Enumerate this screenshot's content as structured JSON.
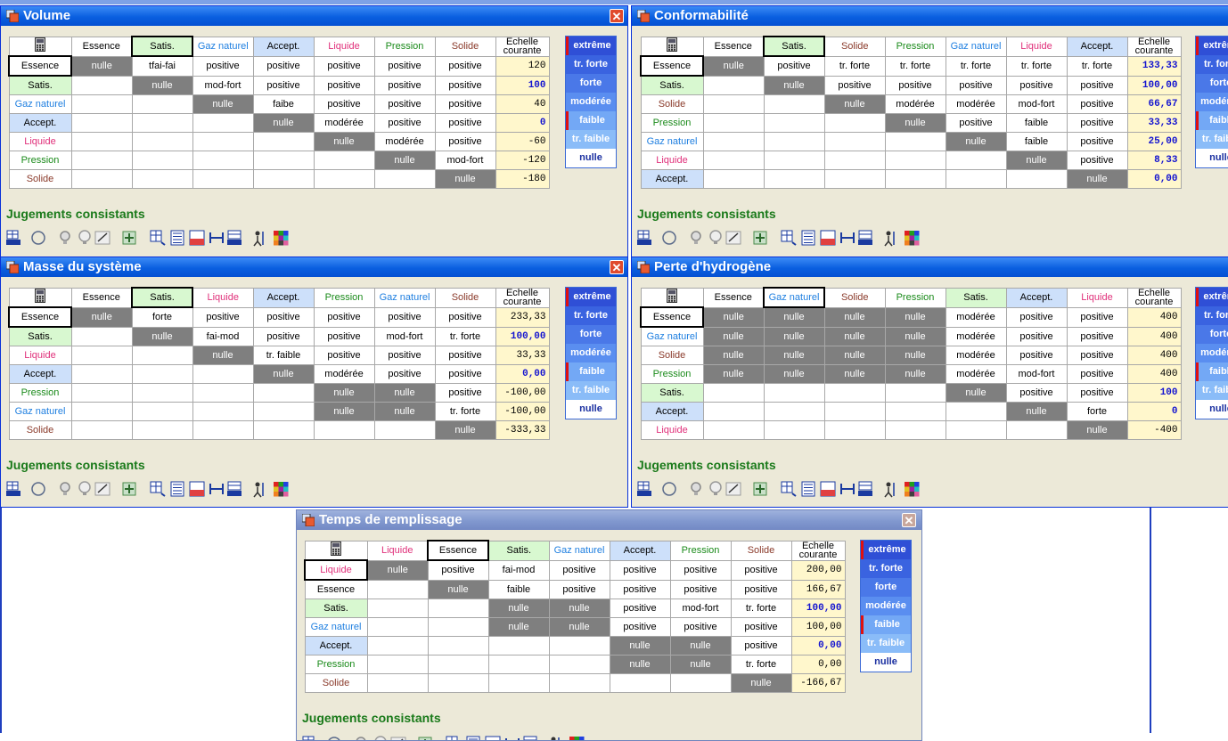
{
  "legend": [
    "extrême",
    "tr. forte",
    "forte",
    "modérée",
    "faible",
    "tr. faible",
    "nulle"
  ],
  "scale_header": [
    "Echelle",
    "courante"
  ],
  "windows": {
    "volume": {
      "title": "Volume",
      "cols": [
        "Essence",
        "Satis.",
        "Gaz naturel",
        "Accept.",
        "Liquide",
        "Pression",
        "Solide"
      ],
      "rows": [
        [
          "nulle",
          "tfai-fai",
          "positive",
          "positive",
          "positive",
          "positive",
          "positive"
        ],
        [
          "",
          "nulle",
          "mod-fort",
          "positive",
          "positive",
          "positive",
          "positive"
        ],
        [
          "",
          "",
          "nulle",
          "faibe",
          "positive",
          "positive",
          "positive"
        ],
        [
          "",
          "",
          "",
          "nulle",
          "modérée",
          "positive",
          "positive"
        ],
        [
          "",
          "",
          "",
          "",
          "nulle",
          "modérée",
          "positive"
        ],
        [
          "",
          "",
          "",
          "",
          "",
          "nulle",
          "mod-fort"
        ],
        [
          "",
          "",
          "",
          "",
          "",
          "",
          "nulle"
        ]
      ],
      "scale": [
        "120",
        "100",
        "40",
        "0",
        "-60",
        "-120",
        "-180"
      ],
      "status": "Jugements consistants"
    },
    "conformabilite": {
      "title": "Conformabilité",
      "cols": [
        "Essence",
        "Satis.",
        "Solide",
        "Pression",
        "Gaz naturel",
        "Liquide",
        "Accept."
      ],
      "rows": [
        [
          "nulle",
          "positive",
          "tr. forte",
          "tr. forte",
          "tr. forte",
          "tr. forte",
          "tr. forte"
        ],
        [
          "",
          "nulle",
          "positive",
          "positive",
          "positive",
          "positive",
          "positive"
        ],
        [
          "",
          "",
          "nulle",
          "modérée",
          "modérée",
          "mod-fort",
          "positive"
        ],
        [
          "",
          "",
          "",
          "nulle",
          "positive",
          "faible",
          "positive"
        ],
        [
          "",
          "",
          "",
          "",
          "nulle",
          "faible",
          "positive"
        ],
        [
          "",
          "",
          "",
          "",
          "",
          "nulle",
          "positive"
        ],
        [
          "",
          "",
          "",
          "",
          "",
          "",
          "nulle"
        ]
      ],
      "scale": [
        "133,33",
        "100,00",
        "66,67",
        "33,33",
        "25,00",
        "8,33",
        "0,00"
      ],
      "status": "Jugements consistants"
    },
    "masse": {
      "title": "Masse du système",
      "cols": [
        "Essence",
        "Satis.",
        "Liquide",
        "Accept.",
        "Pression",
        "Gaz naturel",
        "Solide"
      ],
      "rows": [
        [
          "nulle",
          "forte",
          "positive",
          "positive",
          "positive",
          "positive",
          "positive"
        ],
        [
          "",
          "nulle",
          "fai-mod",
          "positive",
          "positive",
          "mod-fort",
          "tr. forte"
        ],
        [
          "",
          "",
          "nulle",
          "tr. faible",
          "positive",
          "positive",
          "positive"
        ],
        [
          "",
          "",
          "",
          "nulle",
          "modérée",
          "positive",
          "positive"
        ],
        [
          "",
          "",
          "",
          "",
          "nulle",
          "nulle",
          "positive"
        ],
        [
          "",
          "",
          "",
          "",
          "nulle",
          "nulle",
          "tr. forte"
        ],
        [
          "",
          "",
          "",
          "",
          "",
          "",
          "nulle"
        ]
      ],
      "scale": [
        "233,33",
        "100,00",
        "33,33",
        "0,00",
        "-100,00",
        "-100,00",
        "-333,33"
      ],
      "status": "Jugements consistants"
    },
    "perte": {
      "title": "Perte d'hydrogène",
      "cols": [
        "Essence",
        "Gaz naturel",
        "Solide",
        "Pression",
        "Satis.",
        "Accept.",
        "Liquide"
      ],
      "rows": [
        [
          "nulle",
          "nulle",
          "nulle",
          "nulle",
          "modérée",
          "positive",
          "positive"
        ],
        [
          "nulle",
          "nulle",
          "nulle",
          "nulle",
          "modérée",
          "positive",
          "positive"
        ],
        [
          "nulle",
          "nulle",
          "nulle",
          "nulle",
          "modérée",
          "positive",
          "positive"
        ],
        [
          "nulle",
          "nulle",
          "nulle",
          "nulle",
          "modérée",
          "mod-fort",
          "positive"
        ],
        [
          "",
          "",
          "",
          "",
          "nulle",
          "positive",
          "positive"
        ],
        [
          "",
          "",
          "",
          "",
          "",
          "nulle",
          "forte"
        ],
        [
          "",
          "",
          "",
          "",
          "",
          "",
          "nulle"
        ]
      ],
      "scale": [
        "400",
        "400",
        "400",
        "400",
        "100",
        "0",
        "-400"
      ],
      "status": "Jugements consistants"
    },
    "temps": {
      "title": "Temps de remplissage",
      "cols": [
        "Liquide",
        "Essence",
        "Satis.",
        "Gaz naturel",
        "Accept.",
        "Pression",
        "Solide"
      ],
      "rows": [
        [
          "nulle",
          "positive",
          "fai-mod",
          "positive",
          "positive",
          "positive",
          "positive"
        ],
        [
          "",
          "nulle",
          "faible",
          "positive",
          "positive",
          "positive",
          "positive"
        ],
        [
          "",
          "",
          "nulle",
          "nulle",
          "positive",
          "mod-fort",
          "tr. forte"
        ],
        [
          "",
          "",
          "nulle",
          "nulle",
          "positive",
          "positive",
          "positive"
        ],
        [
          "",
          "",
          "",
          "",
          "nulle",
          "nulle",
          "positive"
        ],
        [
          "",
          "",
          "",
          "",
          "nulle",
          "nulle",
          "tr. forte"
        ],
        [
          "",
          "",
          "",
          "",
          "",
          "",
          "nulle"
        ]
      ],
      "scale": [
        "200,00",
        "166,67",
        "100,00",
        "100,00",
        "0,00",
        "0,00",
        "-166,67"
      ],
      "status": "Jugements consistants"
    }
  },
  "colors": {
    "Essence": "#000000",
    "Satis.": "#000000",
    "Gaz naturel": "#1f7fe0",
    "Accept.": "#000000",
    "Liquide": "#e0307a",
    "Pression": "#1a8a1a",
    "Solide": "#8a3a2a"
  },
  "header_bg": {
    "Essence": "#ffffff",
    "Satis.": "#d8f8d0",
    "Gaz naturel": "#ffffff",
    "Accept.": "#cde0fa",
    "Liquide": "#ffffff",
    "Pression": "#ffffff",
    "Solide": "#ffffff"
  },
  "row_bg": {
    "Essence": "#ffffff",
    "Satis.": "#d8f8d0",
    "Gaz naturel": "#ffffff",
    "Accept.": "#cde0fa",
    "Liquide": "#ffffff",
    "Pression": "#ffffff",
    "Solide": "#ffffff"
  }
}
